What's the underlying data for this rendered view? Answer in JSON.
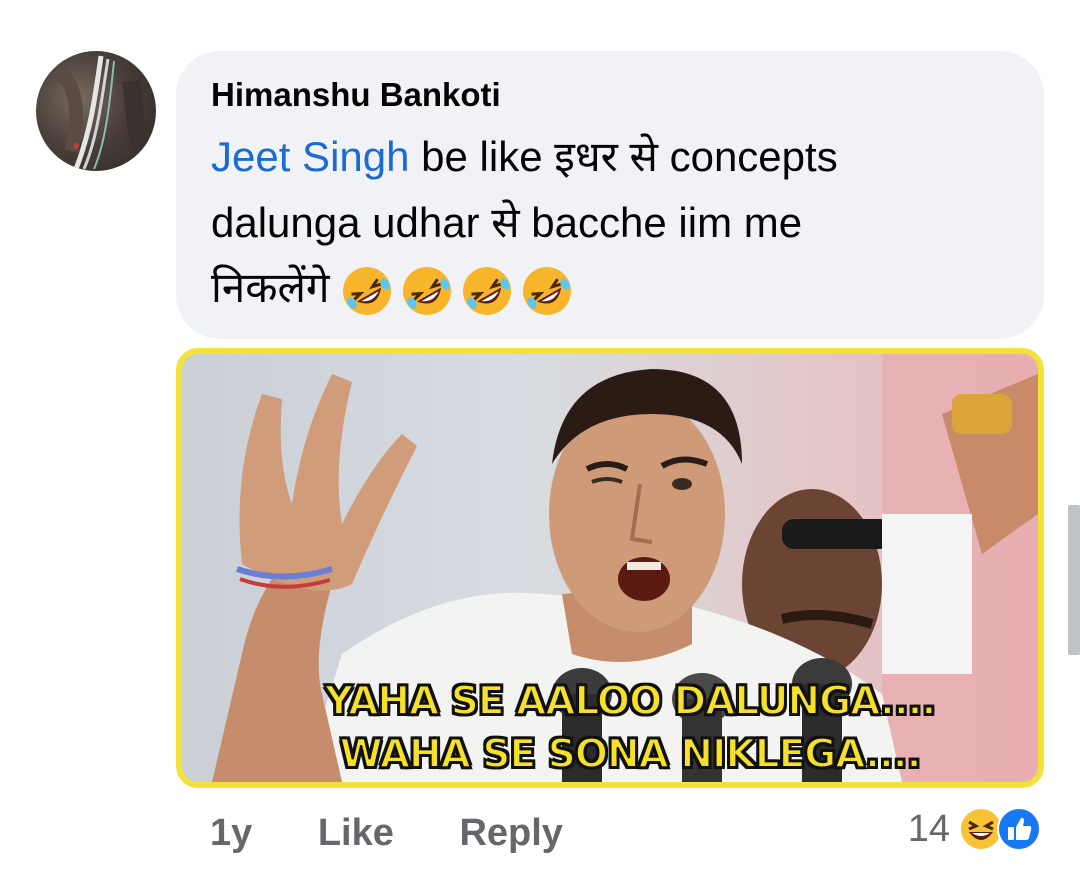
{
  "comment": {
    "author": "Himanshu Bankoti",
    "mention": "Jeet Singh",
    "line1_rest": " be like इधर से concepts",
    "line2": "dalunga udhar से bacche iim me",
    "line3": "निकलेंगे",
    "emoji": [
      "rolling-on-floor-laughing",
      "rolling-on-floor-laughing",
      "rolling-on-floor-laughing",
      "rolling-on-floor-laughing"
    ]
  },
  "meme": {
    "caption_line1": "YAHA SE AALOO DALUNGA....",
    "caption_line2": "WAHA SE SONA NIKLEGA....",
    "border_color": "#f2e23a",
    "caption_color": "#f7e02a"
  },
  "actions": {
    "age": "1y",
    "like_label": "Like",
    "reply_label": "Reply"
  },
  "reactions": {
    "count": "14",
    "icons": [
      "laughing-reaction",
      "like-reaction"
    ]
  },
  "colors": {
    "mention": "#1b6ad6",
    "bubble": "#f0f2f5",
    "meta_text": "#65676b",
    "like_blue": "#1877f2"
  }
}
